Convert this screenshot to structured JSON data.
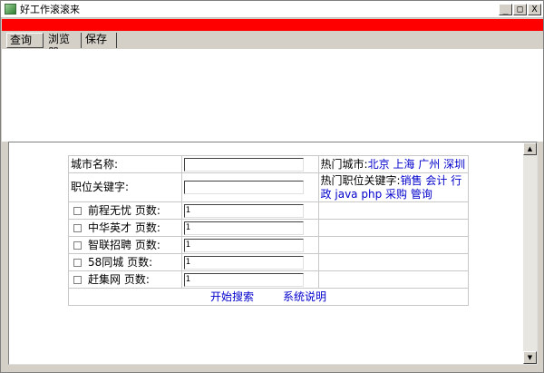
{
  "window": {
    "title": "好工作滚滚来",
    "min_label": "_",
    "max_label": "□",
    "close_label": "X"
  },
  "tabs": [
    {
      "label": "查询"
    },
    {
      "label": "浏览器"
    },
    {
      "label": "保存"
    }
  ],
  "form": {
    "city_label": "城市名称:",
    "city_value": "",
    "hot_cities_label": "热门城市:",
    "hot_cities": [
      "北京",
      "上海",
      "广州",
      "深圳"
    ],
    "keyword_label": "职位关键字:",
    "keyword_value": "",
    "hot_keywords_label": "热门职位关键字:",
    "hot_keywords": [
      "销售",
      "会计",
      "行政",
      "java",
      "php",
      "采购",
      "管询"
    ],
    "sites": [
      {
        "name": "前程无忧",
        "pages_label": "页数:",
        "pages": "1"
      },
      {
        "name": "中华英才",
        "pages_label": "页数:",
        "pages": "1"
      },
      {
        "name": "智联招聘",
        "pages_label": "页数:",
        "pages": "1"
      },
      {
        "name": "58同城",
        "pages_label": "页数:",
        "pages": "1"
      },
      {
        "name": "赶集网",
        "pages_label": "页数:",
        "pages": "1"
      }
    ],
    "start_search": "开始搜索",
    "help": "系统说明"
  },
  "colors": {
    "banner": "#ff0000",
    "link": "#0000cc"
  },
  "icons": {
    "app": "app-icon",
    "scroll_up": "scroll-up-arrow-icon",
    "scroll_down": "scroll-down-arrow-icon"
  }
}
